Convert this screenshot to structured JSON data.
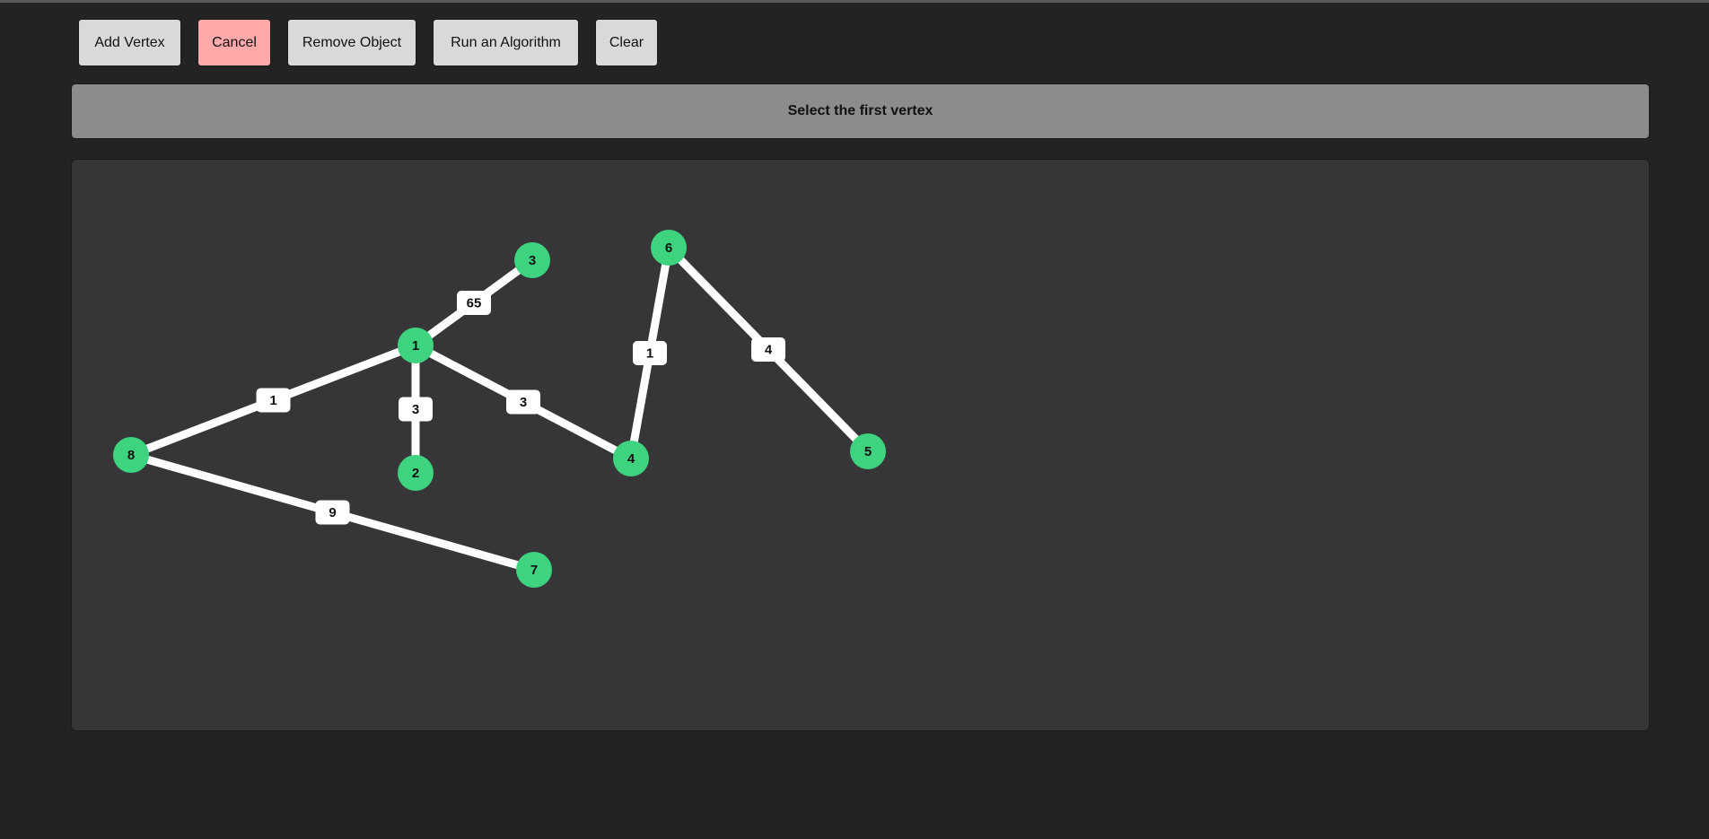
{
  "toolbar": {
    "add_vertex_label": "Add Vertex",
    "cancel_label": "Cancel",
    "remove_object_label": "Remove Object",
    "run_algorithm_label": "Run an Algorithm",
    "clear_label": "Clear"
  },
  "status": {
    "message": "Select the first vertex"
  },
  "colors": {
    "vertex": "#3ed37f",
    "edge": "#ffffff",
    "cancel": "#ffaaaa",
    "button": "#d9d9dc",
    "status_bar": "#8c8c8c",
    "canvas": "#363638"
  },
  "graph": {
    "vertices": [
      {
        "id": "v1",
        "label": "1"
      },
      {
        "id": "v2",
        "label": "2"
      },
      {
        "id": "v3",
        "label": "3"
      },
      {
        "id": "v4",
        "label": "4"
      },
      {
        "id": "v5",
        "label": "5"
      },
      {
        "id": "v6",
        "label": "6"
      },
      {
        "id": "v7",
        "label": "7"
      },
      {
        "id": "v8",
        "label": "8"
      }
    ],
    "edges": [
      {
        "from": "v1",
        "to": "v3",
        "weight": "65"
      },
      {
        "from": "v1",
        "to": "v8",
        "weight": "1"
      },
      {
        "from": "v1",
        "to": "v2",
        "weight": "3"
      },
      {
        "from": "v1",
        "to": "v4",
        "weight": "3"
      },
      {
        "from": "v4",
        "to": "v6",
        "weight": "1"
      },
      {
        "from": "v6",
        "to": "v5",
        "weight": "4"
      },
      {
        "from": "v8",
        "to": "v7",
        "weight": "9"
      }
    ]
  }
}
